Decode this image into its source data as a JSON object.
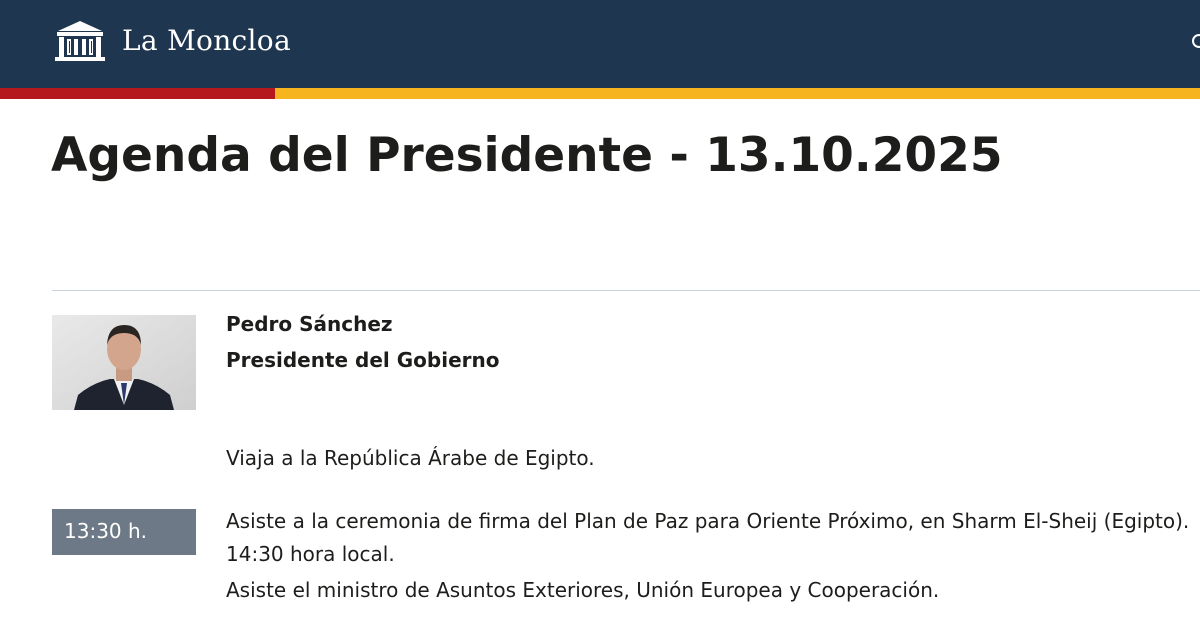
{
  "header": {
    "site_name": "La Moncloa",
    "logo_icon": "moncloa-palace-icon",
    "background_color": "#1e3650",
    "flag_colors": [
      "#b5191e",
      "#f6b51e"
    ]
  },
  "page": {
    "title": "Agenda del Presidente - 13.10.2025"
  },
  "person": {
    "name": "Pedro Sánchez",
    "role": "Presidente del Gobierno",
    "photo_icon": "portrait-photo"
  },
  "agenda": [
    {
      "time": "",
      "lines": [
        "Viaja a la República Árabe de Egipto."
      ]
    },
    {
      "time": "13:30 h.",
      "lines": [
        "Asiste a la ceremonia de firma del Plan de Paz para Oriente Próximo, en Sharm El-Sheij (Egipto).",
        "14:30 hora local.",
        "Asiste el ministro de Asuntos Exteriores, Unión Europea y Cooperación."
      ]
    }
  ]
}
